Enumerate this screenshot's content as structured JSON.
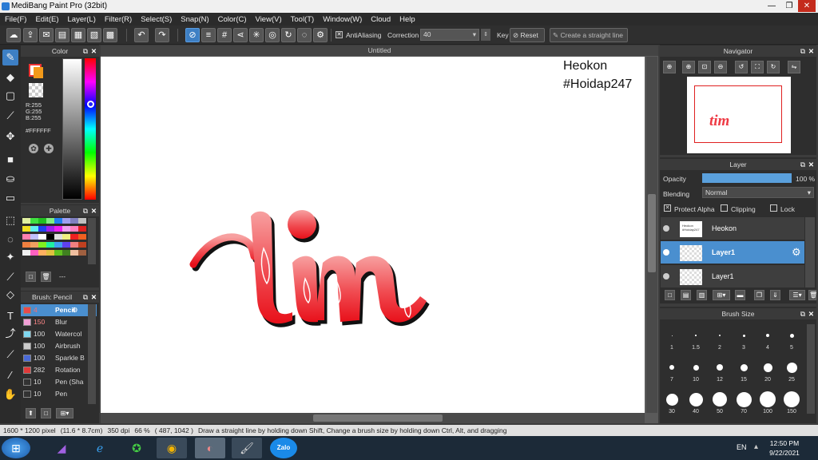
{
  "window": {
    "title": "MediBang Paint Pro (32bit)",
    "controls": [
      "—",
      "❐",
      "✕"
    ]
  },
  "menu": [
    "File(F)",
    "Edit(E)",
    "Layer(L)",
    "Filter(R)",
    "Select(S)",
    "Snap(N)",
    "Color(C)",
    "View(V)",
    "Tool(T)",
    "Window(W)",
    "Cloud",
    "Help"
  ],
  "toolbar": {
    "antialiasing_label": "AntiAliasing",
    "correction_label": "Correction",
    "correction_value": "40",
    "key_label": "Key",
    "reset_label": "Reset",
    "straight_line_label": "Create a straight line"
  },
  "color_panel": {
    "title": "Color",
    "r": "R:255",
    "g": "G:255",
    "b": "B:255",
    "hex": "#FFFFFF"
  },
  "palette_panel": {
    "title": "Palette",
    "extra": "---"
  },
  "brush_panel": {
    "title": "Brush: Pencil",
    "items": [
      {
        "size": "4",
        "name": "Pencil",
        "color": "#e84a4a"
      },
      {
        "size": "150",
        "name": "Blur",
        "color": "#f2a0d6"
      },
      {
        "size": "100",
        "name": "Watercol",
        "color": "#7fd8f0"
      },
      {
        "size": "100",
        "name": "Airbrush",
        "color": "#cccccc"
      },
      {
        "size": "100",
        "name": "Sparkle B",
        "color": "#4a6ad8"
      },
      {
        "size": "282",
        "name": "Rotation",
        "color": "#e03a3a"
      },
      {
        "size": "10",
        "name": "Pen (Sha",
        "color": "#333333"
      },
      {
        "size": "10",
        "name": "Pen",
        "color": "#333333"
      }
    ]
  },
  "canvas": {
    "title": "Untitled",
    "text_line1": "Heokon",
    "text_line2": "#Hoidap247",
    "lettering": "tim"
  },
  "navigator": {
    "title": "Navigator"
  },
  "layer_panel": {
    "title": "Layer",
    "opacity_label": "Opacity",
    "opacity_value": "100 %",
    "opacity": 1.0,
    "blending_label": "Blending",
    "blending_value": "Normal",
    "protect_alpha": "Protect Alpha",
    "clipping": "Clipping",
    "lock": "Lock",
    "layers": [
      {
        "name": "Heokon",
        "thumb": "Heokon\n#Hoidap247",
        "selected": false
      },
      {
        "name": "Layer1",
        "selected": true
      },
      {
        "name": "Layer1",
        "selected": false
      }
    ]
  },
  "brush_size_panel": {
    "title": "Brush Size",
    "sizes": [
      "1",
      "1.5",
      "2",
      "3",
      "4",
      "5",
      "7",
      "10",
      "12",
      "15",
      "20",
      "25",
      "30",
      "40",
      "50",
      "70",
      "100",
      "150"
    ]
  },
  "status": {
    "size": "1600 * 1200 pixel",
    "cm": "(11.6 * 8.7cm)",
    "dpi": "350 dpi",
    "zoom": "66 %",
    "coord": "( 487, 1042 )",
    "hint": "Draw a straight line by holding down Shift, Change a brush size by holding down Ctrl, Alt, and dragging"
  },
  "taskbar": {
    "lang": "EN",
    "time": "12:50 PM",
    "date": "9/22/2021",
    "zalo": "Zalo"
  },
  "colors": {
    "accent": "#3d7fc4",
    "lettering_top": "#f08a8a",
    "lettering_bottom": "#e8101a"
  }
}
